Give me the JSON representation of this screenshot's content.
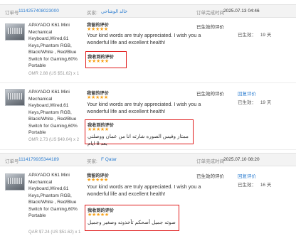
{
  "orders": [
    {
      "order_label": "订单号",
      "order_no": "1114257408023000",
      "buyer_label": "买家:",
      "buyer": "خالد الوشاحي",
      "time_label": "订单完成时间",
      "time": "2025.07.13 04:46",
      "show_header": true,
      "product_title": "APAYADO K61 Mini Mechanical Keyboard,Wired,61 Keys,Phantom RGB, Black/White , Red/Blue Switch for Gaming,60% Portable",
      "price": "OMR 2.88 (US $51.62) x 1",
      "received": {
        "heading": "我收到的评价",
        "stars": "★★★★★"
      },
      "review_status": "已生效的评价",
      "given": {
        "heading": "我留的评价",
        "stars": "★★★★★",
        "text": "Your kind words are truly appreciated. I wish you a wonderful life and excellent health!"
      },
      "reply": "",
      "days_label": "已生效：",
      "days": "19 天"
    },
    {
      "show_header": false,
      "product_title": "APAYADO K61 Mini Mechanical Keyboard,Wired,61 Keys,Phantom RGB, Black/White , Red/Blue Switch for Gaming,60% Portable",
      "price": "OMR 2.73 (US $49.04) x 2",
      "given": {
        "heading": "我留的评价",
        "stars": "★★★★★",
        "text": "Your kind words are truly appreciated. I wish you a wonderful life and excellent health!"
      },
      "received": {
        "heading": "我收到的评价",
        "stars": "★★★★★",
        "text": "ممتاز وفيس الصوره شارته انا من عمان ووصلني بعد 8 ايام"
      },
      "review_status": "已生效的评价",
      "reply": "回复评价",
      "days_label": "已生效：",
      "days": "19 天"
    },
    {
      "order_label": "订单号",
      "order_no": "1114179935344189",
      "buyer_label": "买家:",
      "buyer": "F Qatar",
      "time_label": "订单完成时间",
      "time": "2025.07.10 08:20",
      "show_header": true,
      "product_title": "APAYADO K61 Mini Mechanical Keyboard,Wired,61 Keys,Phantom RGB, Black/White , Red/Blue Switch for Gaming,60% Portable",
      "price": "QAR $7.24 (US $51.62) x 1",
      "given": {
        "heading": "我留的评价",
        "stars": "★★★★★",
        "text": "Your kind words are truly appreciated. I wish you a wonderful life and excellent health!"
      },
      "received": {
        "heading": "我收到的评价",
        "stars": "★★★★★",
        "text": "صوته جميل أصحكم تأخذونه وصغير وجميل"
      },
      "review_status": "已生效的评价",
      "reply": "回复评价",
      "days_label": "已生效：",
      "days": "16 天"
    }
  ]
}
